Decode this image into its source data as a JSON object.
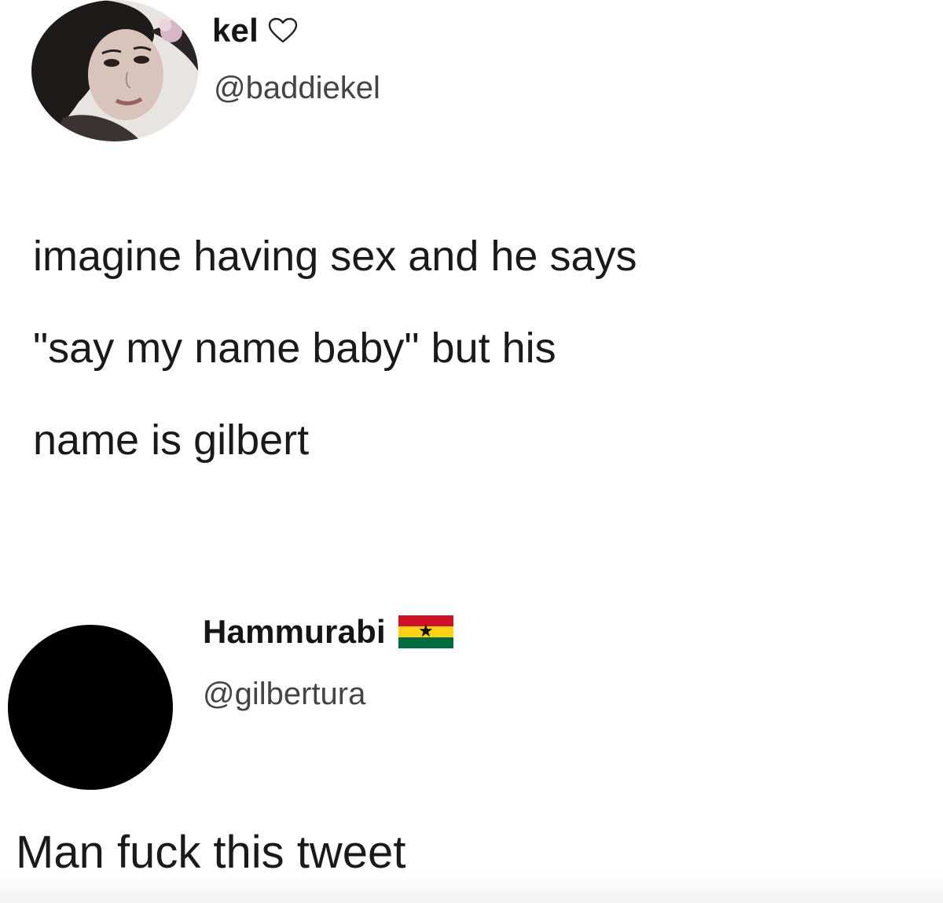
{
  "colors": {
    "heart_stroke": "#222222",
    "flag_red": "#ce1126",
    "flag_gold": "#fcd116",
    "flag_green": "#006b3f",
    "flag_star": "#000000"
  },
  "tweets": [
    {
      "display_name": "kel",
      "name_icon": "heart-outline-icon",
      "handle": "@baddiekel",
      "avatar": "profile-photo",
      "text": "imagine having sex and he says\n\"say my name baby\" but his\nname is gilbert"
    },
    {
      "display_name": "Hammurabi",
      "name_icon": "ghana-flag-icon",
      "flag_star": "★",
      "handle": "@gilbertura",
      "avatar": "black-circle-avatar",
      "text": "Man fuck this tweet"
    }
  ]
}
